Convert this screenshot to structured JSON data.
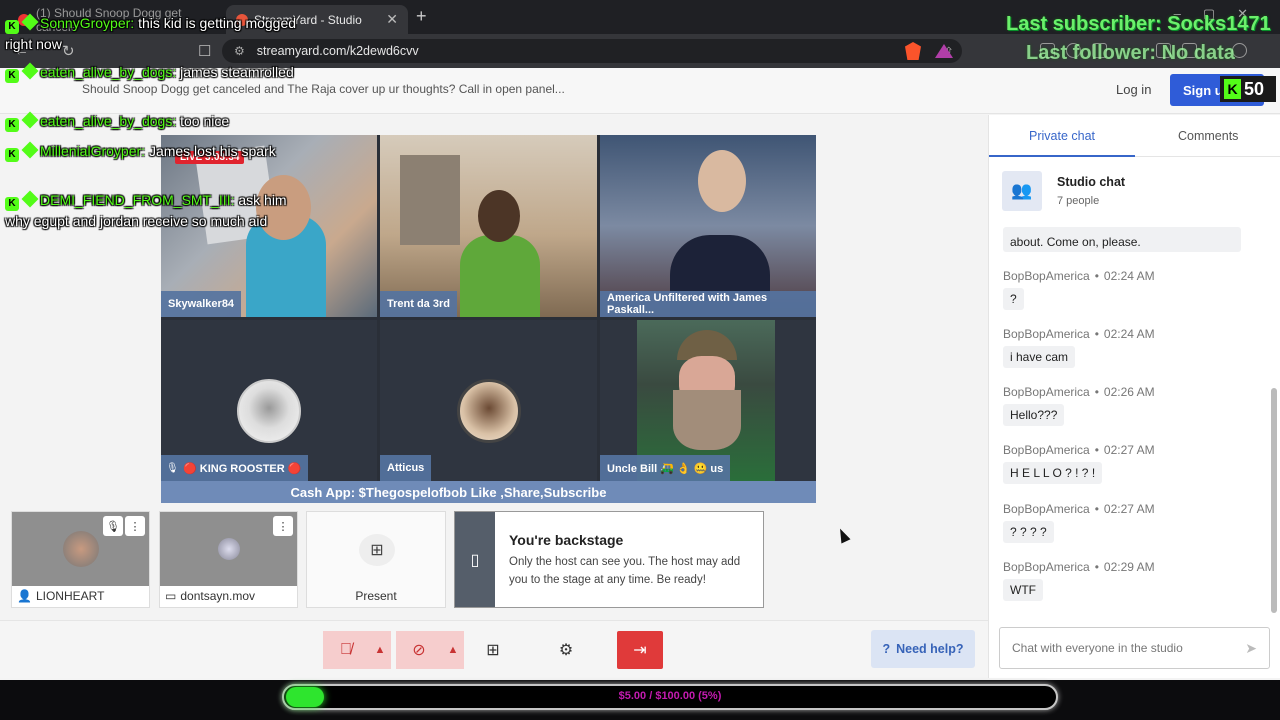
{
  "browser": {
    "tabs": [
      {
        "label": "(1) Should Snoop Dogg get cancele",
        "active": false
      },
      {
        "label": "StreamYard - Studio",
        "active": true
      }
    ],
    "url": "streamyard.com/k2dewd6cvv"
  },
  "header": {
    "title": "Should Snoop Dogg get canceled and The Raja cover up ur thoughts? Call in open panel...",
    "login_label": "Log in",
    "signup_label": "Sign up free"
  },
  "stage": {
    "live_label": "LIVE 3:03:34",
    "tiles": [
      {
        "name": "Skywalker84"
      },
      {
        "name": "Trent da 3rd"
      },
      {
        "name": "America Unfiltered with James Paskall..."
      },
      {
        "name": "🔴 KING ROOSTER 🔴"
      },
      {
        "name": "Atticus"
      },
      {
        "name": "Uncle Bill 🛺 👌 🤐 us"
      }
    ],
    "banner": "Cash App: $Thegospelofbob Like ,Share,Subscribe"
  },
  "backstage": {
    "guests": [
      {
        "name": "LIONHEART"
      },
      {
        "name": "dontsayn.mov"
      }
    ],
    "present_label": "Present",
    "note_title": "You're backstage",
    "note_body": "Only the host can see you. The host may add you to the stage at any time. Be ready!"
  },
  "controls": {
    "help_label": "Need help?"
  },
  "chat": {
    "tabs": [
      "Private chat",
      "Comments"
    ],
    "studio_title": "Studio chat",
    "studio_sub": "7 people",
    "partial_message": "about. Come on, please.",
    "messages": [
      {
        "user": "BopBopAmerica",
        "time": "02:24 AM",
        "text": "?"
      },
      {
        "user": "BopBopAmerica",
        "time": "02:24 AM",
        "text": "i have cam"
      },
      {
        "user": "BopBopAmerica",
        "time": "02:26 AM",
        "text": "Hello???"
      },
      {
        "user": "BopBopAmerica",
        "time": "02:27 AM",
        "text": "H E L L O ? ! ? !"
      },
      {
        "user": "BopBopAmerica",
        "time": "02:27 AM",
        "text": "? ? ? ?"
      },
      {
        "user": "BopBopAmerica",
        "time": "02:29 AM",
        "text": "WTF"
      }
    ],
    "input_placeholder": "Chat with everyone in the studio"
  },
  "overlay": {
    "last_subscriber": "Last subscriber: Socks1471",
    "last_follower": "Last follower: No data",
    "viewer_count": "50",
    "chat_lines": [
      {
        "user": "SonnyGroyper:",
        "text": "this kid is getting mogged right now"
      },
      {
        "user": "eaten_alive_by_dogs:",
        "text": "james steamrolled"
      },
      {
        "user": "eaten_alive_by_dogs:",
        "text": "too nice"
      },
      {
        "user": "MillenialGroyper:",
        "text": "James lost his spark"
      },
      {
        "user": "DEMI_FIEND_FROM_SMT_III:",
        "text": "ask him why egupt and jordan receive so much aid"
      }
    ],
    "donation": {
      "label": "$5.00 / $100.00 (5%)",
      "progress": 0.05
    }
  },
  "colors": {
    "accent": "#3766c9",
    "kick_green": "#53fc18",
    "end_red": "#e03a3a"
  }
}
